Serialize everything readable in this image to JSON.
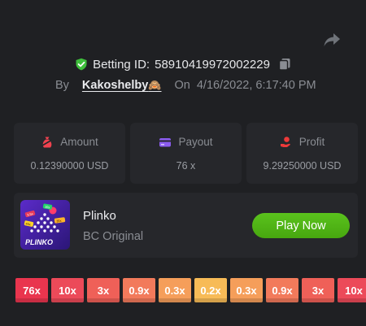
{
  "header": {
    "share_icon": "share-arrow-icon",
    "betting_label": "Betting ID:",
    "betting_id": "58910419972002229",
    "shield_icon": "shield-check-icon",
    "copy_icon": "copy-icon",
    "by_label": "By",
    "username": "Kakoshelby",
    "username_emoji": "🙈",
    "on_label": "On",
    "timestamp": "4/16/2022, 6:17:40 PM"
  },
  "stats": {
    "amount": {
      "label": "Amount",
      "value": "0.12390000 USD",
      "icon": "money-bag-icon"
    },
    "payout": {
      "label": "Payout",
      "value": "76 x",
      "icon": "credit-card-icon"
    },
    "profit": {
      "label": "Profit",
      "value": "9.29250000 USD",
      "icon": "coins-hand-icon"
    }
  },
  "game": {
    "name": "Plinko",
    "provider": "BC Original",
    "thumbnail_text": "PLINKO",
    "thumbnail_tags": [
      "3.5x",
      "10x",
      "35x",
      "46x"
    ],
    "play_label": "Play Now"
  },
  "multipliers": [
    {
      "label": "76x",
      "color": "#e9354e"
    },
    {
      "label": "10x",
      "color": "#ec4a59"
    },
    {
      "label": "3x",
      "color": "#ef6058"
    },
    {
      "label": "0.9x",
      "color": "#f27a5b"
    },
    {
      "label": "0.3x",
      "color": "#f59e5a"
    },
    {
      "label": "0.2x",
      "color": "#f7bb57"
    },
    {
      "label": "0.3x",
      "color": "#f59e5a"
    },
    {
      "label": "0.9x",
      "color": "#f27a5b"
    },
    {
      "label": "3x",
      "color": "#ef6058"
    },
    {
      "label": "10x",
      "color": "#ec4a59"
    }
  ],
  "colors": {
    "background": "#1f2023",
    "card": "#26272b",
    "accent_green": "#4fb615",
    "amount_icon": "#f0424f",
    "payout_icon": "#8c5cf0",
    "profit_icon": "#ee3a3a"
  }
}
